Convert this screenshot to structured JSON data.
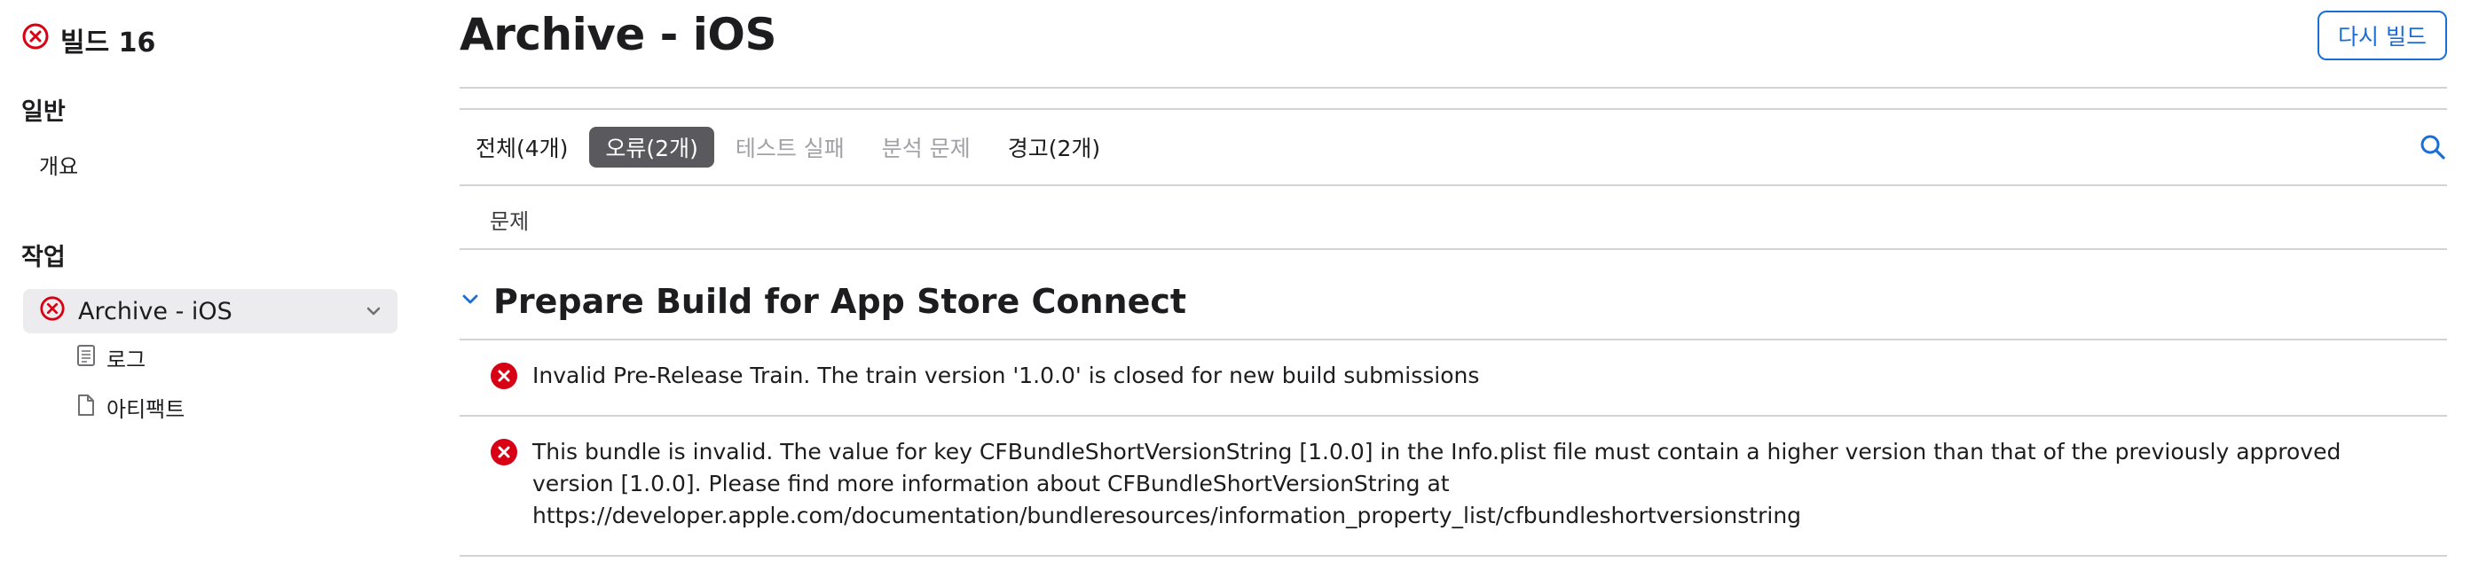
{
  "sidebar": {
    "build_title": "빌드 16",
    "section_general": "일반",
    "overview_label": "개요",
    "section_actions": "작업",
    "workflow_label": "Archive - iOS",
    "log_label": "로그",
    "artifacts_label": "아티팩트"
  },
  "header": {
    "title": "Archive - iOS",
    "rebuild_label": "다시 빌드"
  },
  "tabs": [
    {
      "label": "전체(4개)",
      "state": "normal"
    },
    {
      "label": "오류(2개)",
      "state": "active"
    },
    {
      "label": "테스트 실패",
      "state": "disabled"
    },
    {
      "label": "분석 문제",
      "state": "disabled"
    },
    {
      "label": "경고(2개)",
      "state": "normal"
    }
  ],
  "table": {
    "column_header": "문제"
  },
  "group": {
    "title": "Prepare Build for App Store Connect"
  },
  "issues": [
    {
      "text": "Invalid Pre-Release Train. The train version '1.0.0' is closed for new build submissions",
      "severity": "error"
    },
    {
      "text": "This bundle is invalid. The value for key CFBundleShortVersionString [1.0.0] in the Info.plist file must contain a higher version than that of the previously approved version [1.0.0]. Please find more information about CFBundleShortVersionString at https://developer.apple.com/documentation/bundleresources/information_property_list/cfbundleshortversionstring",
      "severity": "error"
    }
  ],
  "colors": {
    "error": "#d70015",
    "accent": "#1a6fd6",
    "active_tab": "#5a5a5e",
    "divider": "#d2d2d7"
  },
  "icons": {
    "build_status": "error-circle-icon",
    "workflow_status": "error-circle-icon",
    "log": "document-lines-icon",
    "artifacts": "document-icon",
    "search": "search-icon",
    "chevron": "chevron-down-icon",
    "issue": "error-filled-icon"
  }
}
